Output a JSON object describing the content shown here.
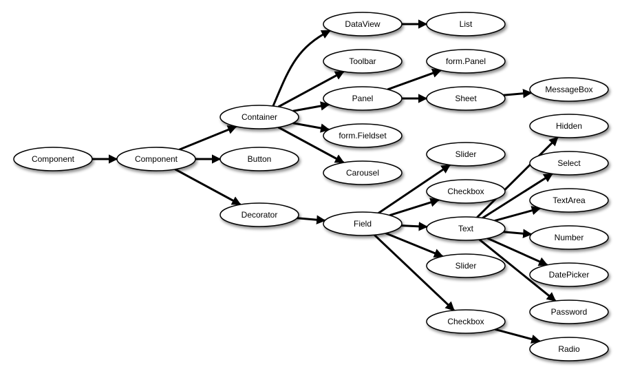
{
  "diagram": {
    "nodes": [
      {
        "id": "component1",
        "label": "Component"
      },
      {
        "id": "component2",
        "label": "Component"
      },
      {
        "id": "container",
        "label": "Container"
      },
      {
        "id": "button",
        "label": "Button"
      },
      {
        "id": "decorator",
        "label": "Decorator"
      },
      {
        "id": "dataview",
        "label": "DataView"
      },
      {
        "id": "toolbar",
        "label": "Toolbar"
      },
      {
        "id": "panel",
        "label": "Panel"
      },
      {
        "id": "formfieldset",
        "label": "form.Fieldset"
      },
      {
        "id": "carousel",
        "label": "Carousel"
      },
      {
        "id": "field",
        "label": "Field"
      },
      {
        "id": "list",
        "label": "List"
      },
      {
        "id": "formpanel",
        "label": "form.Panel"
      },
      {
        "id": "sheet",
        "label": "Sheet"
      },
      {
        "id": "slider1",
        "label": "Slider"
      },
      {
        "id": "checkbox1",
        "label": "Checkbox"
      },
      {
        "id": "text",
        "label": "Text"
      },
      {
        "id": "slider2",
        "label": "Slider"
      },
      {
        "id": "checkbox2",
        "label": "Checkbox"
      },
      {
        "id": "messagebox",
        "label": "MessageBox"
      },
      {
        "id": "hidden",
        "label": "Hidden"
      },
      {
        "id": "select",
        "label": "Select"
      },
      {
        "id": "textarea",
        "label": "TextArea"
      },
      {
        "id": "number",
        "label": "Number"
      },
      {
        "id": "datepicker",
        "label": "DatePicker"
      },
      {
        "id": "password",
        "label": "Password"
      },
      {
        "id": "radio",
        "label": "Radio"
      }
    ],
    "edges": [
      {
        "from": "component1",
        "to": "component2"
      },
      {
        "from": "component2",
        "to": "container"
      },
      {
        "from": "component2",
        "to": "button"
      },
      {
        "from": "component2",
        "to": "decorator"
      },
      {
        "from": "container",
        "to": "dataview"
      },
      {
        "from": "container",
        "to": "toolbar"
      },
      {
        "from": "container",
        "to": "panel"
      },
      {
        "from": "container",
        "to": "formfieldset"
      },
      {
        "from": "container",
        "to": "carousel"
      },
      {
        "from": "decorator",
        "to": "field"
      },
      {
        "from": "dataview",
        "to": "list"
      },
      {
        "from": "panel",
        "to": "formpanel"
      },
      {
        "from": "panel",
        "to": "sheet"
      },
      {
        "from": "sheet",
        "to": "messagebox"
      },
      {
        "from": "field",
        "to": "slider1"
      },
      {
        "from": "field",
        "to": "checkbox1"
      },
      {
        "from": "field",
        "to": "text"
      },
      {
        "from": "field",
        "to": "slider2"
      },
      {
        "from": "field",
        "to": "checkbox2"
      },
      {
        "from": "text",
        "to": "hidden"
      },
      {
        "from": "text",
        "to": "select"
      },
      {
        "from": "text",
        "to": "textarea"
      },
      {
        "from": "text",
        "to": "number"
      },
      {
        "from": "text",
        "to": "datepicker"
      },
      {
        "from": "text",
        "to": "password"
      },
      {
        "from": "checkbox2",
        "to": "radio"
      }
    ]
  }
}
